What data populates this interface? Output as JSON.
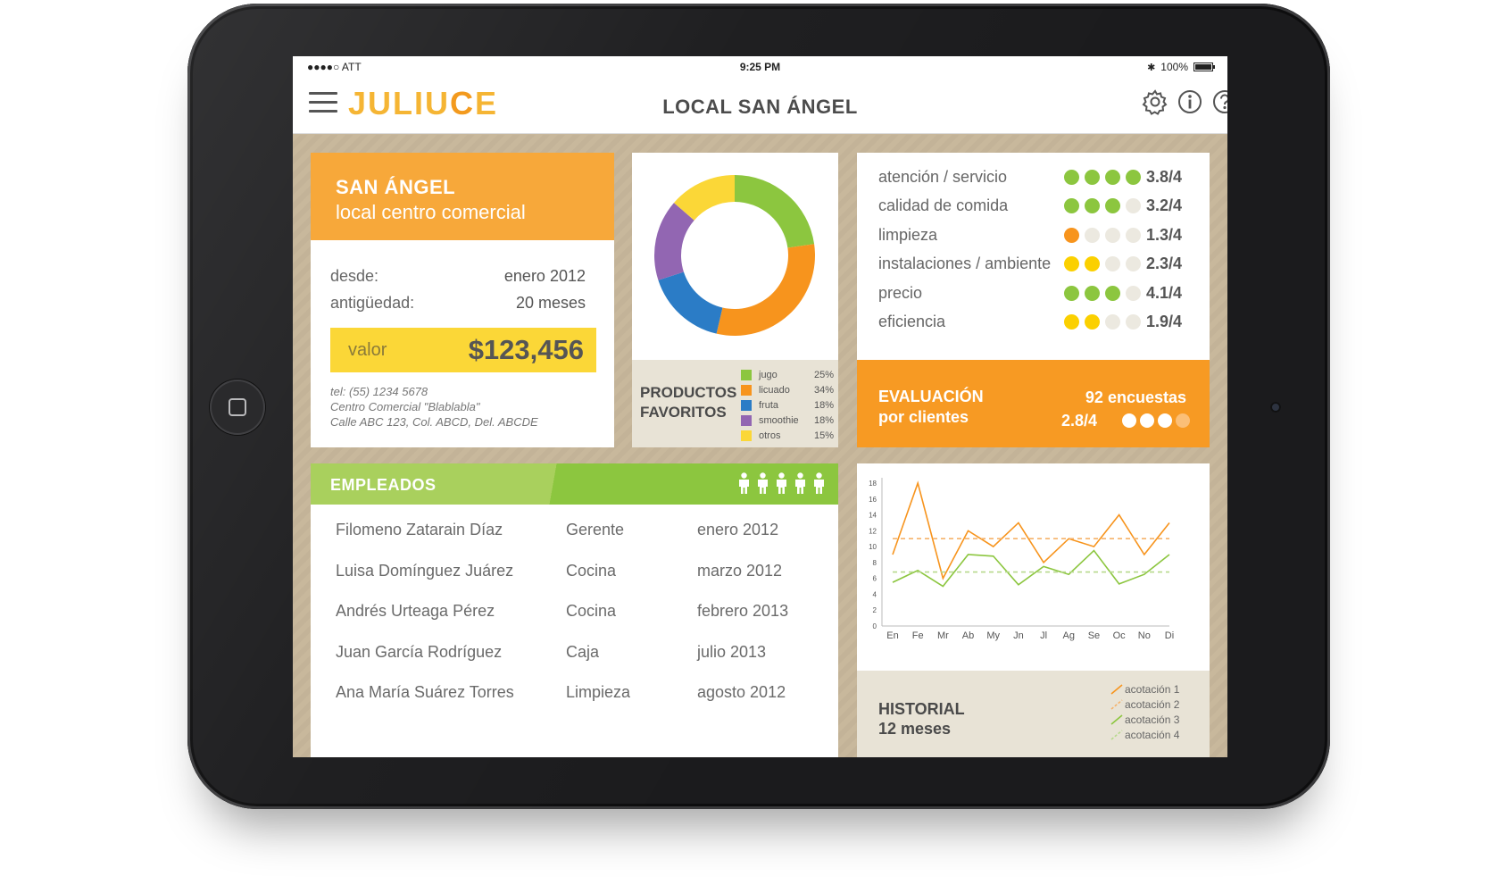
{
  "status": {
    "carrier": "●●●●○ ATT",
    "time": "9:25 PM",
    "battery": "100%"
  },
  "nav": {
    "logo_a": "JULIU",
    "logo_b": "C",
    "logo_c": "E",
    "title": "LOCAL SAN ÁNGEL"
  },
  "local": {
    "title": "SAN ÁNGEL",
    "subtitle": "local centro comercial",
    "since_label": "desde:",
    "since_value": "enero 2012",
    "age_label": "antigüedad:",
    "age_value": "20 meses",
    "value_label": "valor",
    "value_amount": "$123,456",
    "contact": [
      "tel: (55) 1234 5678",
      "Centro Comercial \"Blablabla\"",
      "Calle ABC 123, Col. ABCD, Del. ABCDE"
    ]
  },
  "products": {
    "title_line1": "PRODUCTOS",
    "title_line2": "FAVORITOS",
    "items": [
      {
        "name": "jugo",
        "pct": "25%",
        "value": 25,
        "color": "#8cc63f"
      },
      {
        "name": "licuado",
        "pct": "34%",
        "value": 34,
        "color": "#f7941d"
      },
      {
        "name": "fruta",
        "pct": "18%",
        "value": 18,
        "color": "#2b7cc6"
      },
      {
        "name": "smoothie",
        "pct": "18%",
        "value": 18,
        "color": "#9266b2"
      },
      {
        "name": "otros",
        "pct": "15%",
        "value": 15,
        "color": "#fbd737"
      }
    ]
  },
  "ratings": [
    {
      "label": "atención / servicio",
      "value": "3.8/4",
      "filled": 4,
      "color": "#8cc63f"
    },
    {
      "label": "calidad de comida",
      "value": "3.2/4",
      "filled": 3,
      "color": "#8cc63f"
    },
    {
      "label": "limpieza",
      "value": "1.3/4",
      "filled": 1,
      "color": "#f7941d"
    },
    {
      "label": "instalaciones / ambiente",
      "value": "2.3/4",
      "filled": 2,
      "color": "#fbd000"
    },
    {
      "label": "precio",
      "value": "4.1/4",
      "filled": 3,
      "color": "#8cc63f"
    },
    {
      "label": "eficiencia",
      "value": "1.9/4",
      "filled": 2,
      "color": "#fbd000"
    }
  ],
  "evaluation": {
    "title_line1": "EVALUACIÓN",
    "title_line2": "por clientes",
    "count": "92 encuestas",
    "score": "2.8/4",
    "filled": 3
  },
  "employees": {
    "title": "EMPLEADOS",
    "icon_count": 5,
    "rows": [
      {
        "name": "Filomeno Zatarain Díaz",
        "role": "Gerente",
        "date": "enero 2012"
      },
      {
        "name": "Luisa Domínguez Juárez",
        "role": "Cocina",
        "date": "marzo 2012"
      },
      {
        "name": "Andrés Urteaga Pérez",
        "role": "Cocina",
        "date": "febrero 2013"
      },
      {
        "name": "Juan García Rodríguez",
        "role": "Caja",
        "date": "julio 2013"
      },
      {
        "name": "Ana María Suárez Torres",
        "role": "Limpieza",
        "date": "agosto 2012"
      }
    ]
  },
  "history": {
    "title_line1": "HISTORIAL",
    "title_line2": "12 meses",
    "legend": [
      "acotación 1",
      "acotación 2",
      "acotación 3",
      "acotación 4"
    ]
  },
  "chart_data": {
    "type": "line",
    "categories": [
      "En",
      "Fe",
      "Mr",
      "Ab",
      "My",
      "Jn",
      "Jl",
      "Ag",
      "Se",
      "Oc",
      "No",
      "Di"
    ],
    "ylim": [
      0,
      18
    ],
    "yticks": [
      0,
      2,
      4,
      6,
      8,
      10,
      12,
      14,
      16,
      18
    ],
    "series": [
      {
        "name": "acotación 1",
        "color": "#f7941d",
        "style": "solid",
        "values": [
          9,
          18,
          6,
          12,
          10,
          13,
          8,
          11,
          10,
          14,
          9,
          13
        ]
      },
      {
        "name": "acotación 2",
        "color": "#f5b26b",
        "style": "dashed",
        "values": [
          11,
          11,
          11,
          11,
          11,
          11,
          11,
          11,
          11,
          11,
          11,
          11
        ]
      },
      {
        "name": "acotación 3",
        "color": "#8cc63f",
        "style": "solid",
        "values": [
          5.5,
          7,
          5,
          9,
          8.8,
          5.2,
          7.5,
          6.5,
          9.5,
          5.3,
          6.5,
          9
        ]
      },
      {
        "name": "acotación 4",
        "color": "#b7d98c",
        "style": "dashed",
        "values": [
          6.8,
          6.8,
          6.8,
          6.8,
          6.8,
          6.8,
          6.8,
          6.8,
          6.8,
          6.8,
          6.8,
          6.8
        ]
      }
    ],
    "grid": false
  }
}
